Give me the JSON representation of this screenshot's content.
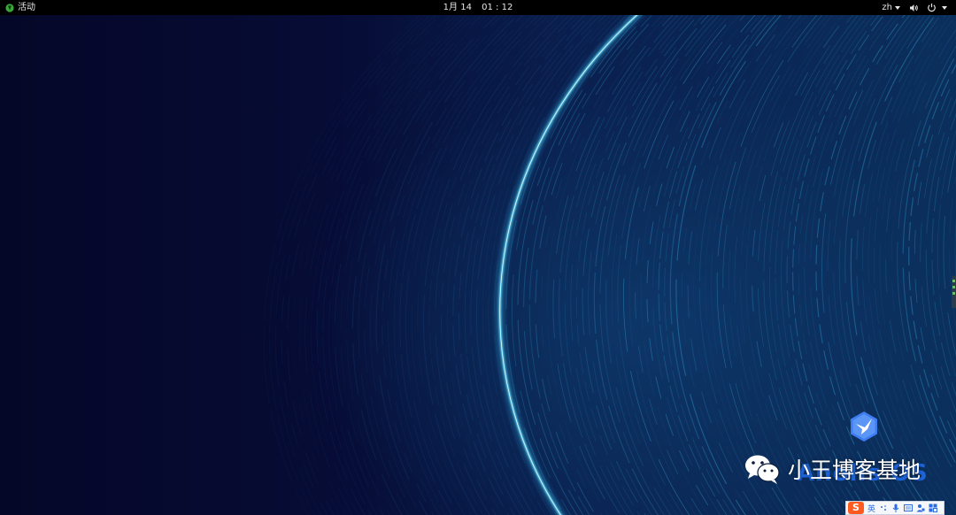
{
  "topbar": {
    "activities_label": "活动",
    "clock": {
      "date": "1月 14",
      "time": "01 : 12"
    },
    "language": "zh",
    "icons": {
      "activities": "app-logo-icon",
      "volume": "volume-icon",
      "power": "power-icon",
      "dropdown": "chevron-down-icon"
    }
  },
  "desktop": {
    "os_name": "Anolis OS",
    "watermark_text": "小王博客基地",
    "colors": {
      "background": "#050a2a",
      "arc_highlight": "#5fe0ff",
      "streaks": "#1b6e9a",
      "os_name": "#1e63d8"
    }
  },
  "ime": {
    "brand_glyph": "S",
    "mode": "英",
    "icons": [
      "punctuation-icon",
      "microphone-icon",
      "keyboard-icon",
      "user-icon",
      "grid-icon"
    ]
  }
}
